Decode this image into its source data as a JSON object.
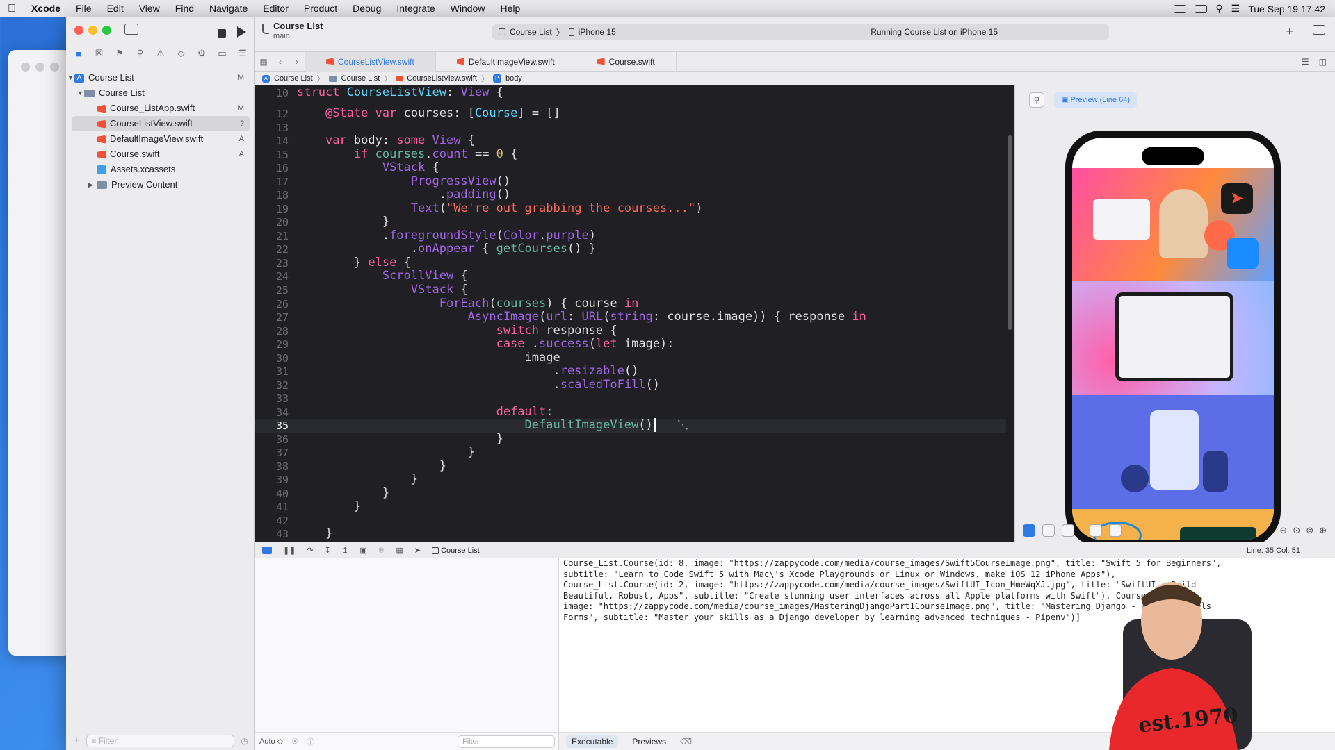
{
  "menubar": {
    "app": "Xcode",
    "items": [
      "File",
      "Edit",
      "View",
      "Find",
      "Navigate",
      "Editor",
      "Product",
      "Debug",
      "Integrate",
      "Window",
      "Help"
    ],
    "clock": "Tue Sep 19  17:42"
  },
  "toolbar": {
    "project": "Course List",
    "branch": "main",
    "scheme_target": "Course List",
    "scheme_sep": "〉",
    "device": "iPhone 15",
    "status": "Running Course List on iPhone 15"
  },
  "tabs": [
    "CourseListView.swift",
    "DefaultImageView.swift",
    "Course.swift"
  ],
  "jumpbar": [
    "Course List",
    "Course List",
    "CourseListView.swift",
    "body"
  ],
  "navigator": [
    {
      "label": "Course List",
      "status": "M"
    },
    {
      "label": "Course List",
      "status": ""
    },
    {
      "label": "Course_ListApp.swift",
      "status": "M"
    },
    {
      "label": "CourseListView.swift",
      "status": "?"
    },
    {
      "label": "DefaultImageView.swift",
      "status": "A"
    },
    {
      "label": "Course.swift",
      "status": "A"
    },
    {
      "label": "Assets.xcassets",
      "status": ""
    },
    {
      "label": "Preview Content",
      "status": ""
    }
  ],
  "navigator_filter": "Filter",
  "editor": {
    "line_numbers": [
      "10",
      "12",
      "13",
      "14",
      "15",
      "16",
      "17",
      "18",
      "19",
      "20",
      "21",
      "22",
      "23",
      "24",
      "25",
      "26",
      "27",
      "28",
      "29",
      "30",
      "31",
      "32",
      "33",
      "34",
      "35",
      "36",
      "37",
      "38",
      "39",
      "40",
      "41",
      "42",
      "43"
    ],
    "current_line": "35"
  },
  "preview": {
    "button": "Preview (Line 64)"
  },
  "debug": {
    "target": "Course List",
    "position": "Line: 35  Col: 51"
  },
  "variables": {
    "scope": "Auto ◇",
    "filter": "Filter"
  },
  "console": {
    "lines": [
      "Course_List.Course(id: 8, image: \"https://zappycode.com/media/course_images/Swift5CourseImage.png\", title: \"Swift 5 for Beginners\",",
      "subtitle: \"Learn to Code Swift 5 with Mac\\'s Xcode Playgrounds or Linux or Windows. make iOS 12 iPhone Apps\"),",
      "Course_List.Course(id: 2, image: \"https://zappycode.com/media/course_images/SwiftUI_Icon_HmeWqXJ.jpg\", title: \"SwiftUI - Build",
      "Beautiful, Robust, Apps\", subtitle: \"Create stunning user interfaces across all Apple platforms with Swift\"), Course(id: 3,",
      "image: \"https://zappycode.com/media/course_images/MasteringDjangoPart1CourseImage.png\", title: \"Mastering Django - Part 1: Models",
      "Forms\", subtitle: \"Master your skills as a Django developer by learning advanced techniques - Pipenv\")]"
    ],
    "tabs": [
      "Executable",
      "Previews"
    ],
    "filter": "Filter"
  },
  "presenter_shirt": "est.1970"
}
